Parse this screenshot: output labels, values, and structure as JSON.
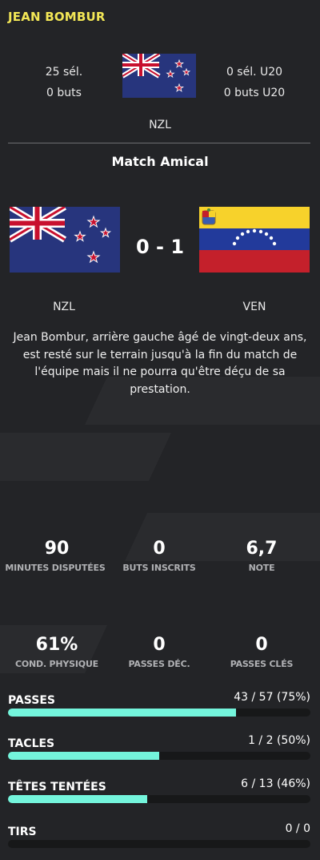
{
  "player": {
    "name": "JEAN BOMBUR",
    "caps": "25 sél.",
    "goals": "0 buts",
    "caps_u20": "0 sél. U20",
    "goals_u20": "0 buts U20",
    "nation": "NZL"
  },
  "match": {
    "title": "Match Amical",
    "home_team": "NZL",
    "away_team": "VEN",
    "score": "0 - 1",
    "description": "Jean Bombur, arrière gauche âgé de vingt-deux ans, est resté sur le terrain jusqu'à la fin du match de l'équipe mais il ne pourra qu'être déçu de sa prestation."
  },
  "stats_row1": [
    {
      "value": "90",
      "label": "MINUTES DISPUTÉES"
    },
    {
      "value": "0",
      "label": "BUTS INSCRITS"
    },
    {
      "value": "6,7",
      "label": "NOTE"
    }
  ],
  "stats_row2": [
    {
      "value": "61%",
      "label": "COND. PHYSIQUE"
    },
    {
      "value": "0",
      "label": "PASSES DÉC."
    },
    {
      "value": "0",
      "label": "PASSES CLÉS"
    }
  ],
  "bars": [
    {
      "label": "PASSES",
      "value": "43 / 57 (75%)",
      "fraction": 0.754
    },
    {
      "label": "TACLES",
      "value": "1 / 2 (50%)",
      "fraction": 0.5
    },
    {
      "label": "TÊTES TENTÉES",
      "value": "6 / 13 (46%)",
      "fraction": 0.46
    },
    {
      "label": "TIRS",
      "value": "0 / 0",
      "fraction": 0
    }
  ],
  "colors": {
    "accent_name": "#f3e756",
    "bar_fill": "#74f5dc",
    "bar_track": "#171819",
    "background": "#232427"
  },
  "icons": {
    "home_flag": "new-zealand-flag",
    "away_flag": "venezuela-flag"
  }
}
